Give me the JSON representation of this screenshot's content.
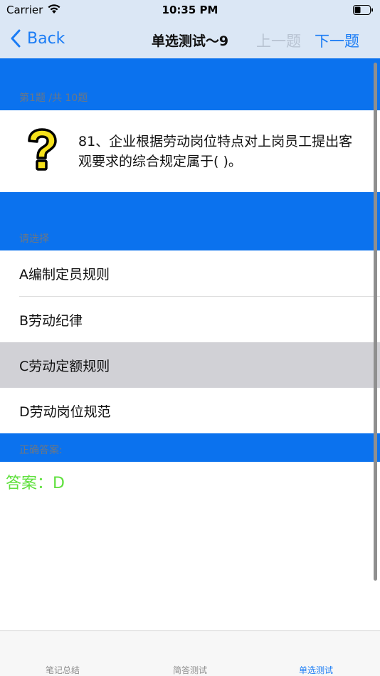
{
  "status_bar": {
    "carrier": "Carrier",
    "time": "10:35 PM"
  },
  "nav": {
    "back_label": "Back",
    "title": "单选测试～9",
    "prev_label": "上一题",
    "next_label": "下一题"
  },
  "question": {
    "counter": "第1题 /共 10题",
    "text": "81、企业根据劳动岗位特点对上岗员工提出客观要求的综合规定属于(   )。",
    "icon": "question-mark-icon"
  },
  "choices": {
    "header": "请选择",
    "options": [
      {
        "label": "A编制定员规则",
        "selected": false
      },
      {
        "label": "B劳动纪律",
        "selected": false
      },
      {
        "label": "C劳动定额规则",
        "selected": true
      },
      {
        "label": "D劳动岗位规范",
        "selected": false
      }
    ]
  },
  "answer": {
    "header": "正确答案:",
    "text": "答案：D"
  },
  "tabs": [
    {
      "label": "笔记总结",
      "active": false
    },
    {
      "label": "简答测试",
      "active": false
    },
    {
      "label": "单选测试",
      "active": true
    }
  ],
  "colors": {
    "accent": "#1a7cf5",
    "band": "#0b72ee",
    "answer": "#5ee03c",
    "selected_row": "#d1d1d6"
  }
}
